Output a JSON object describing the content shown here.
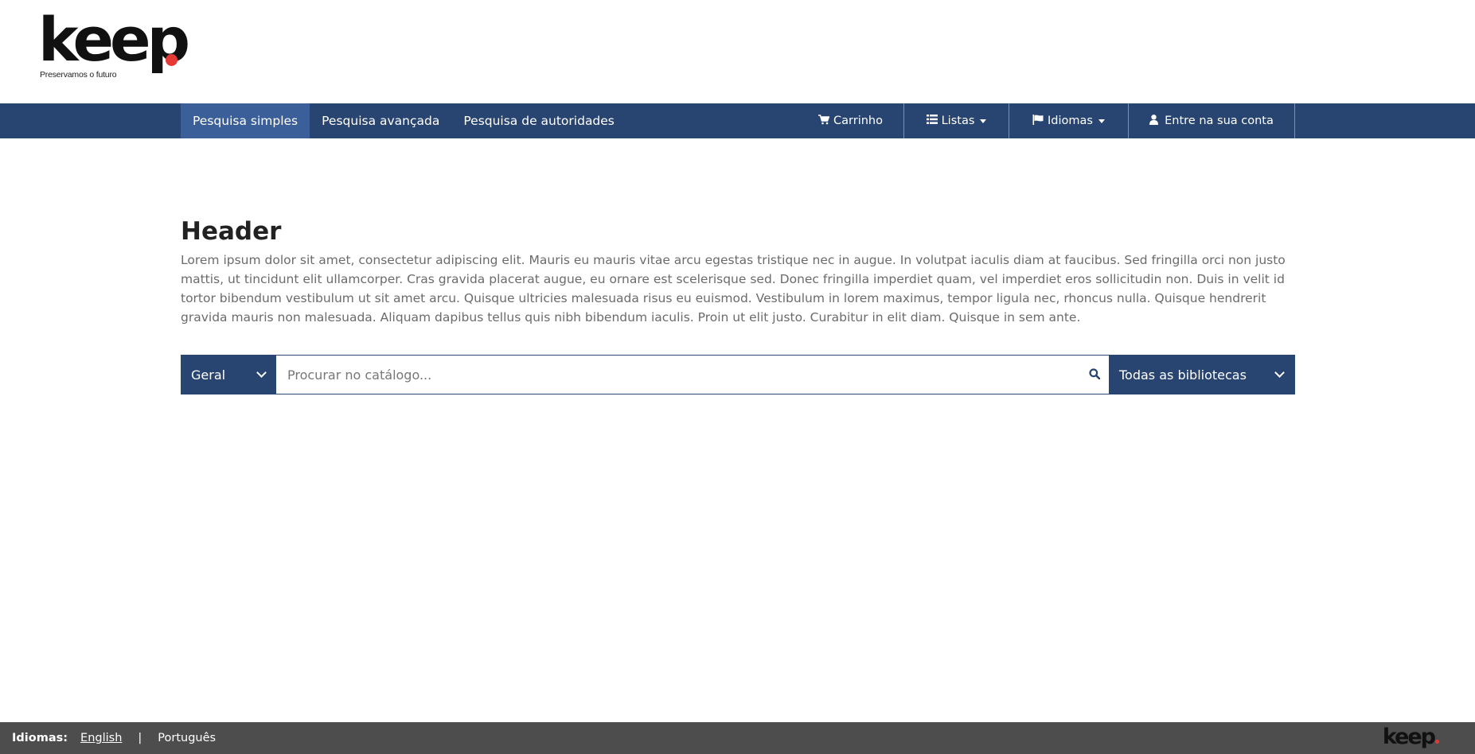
{
  "colors": {
    "primary": "#284471",
    "active_nav": "#3a5f99",
    "accent_dot": "#e53935",
    "footer_bg": "#4d4d4d"
  },
  "logo": {
    "word": "keep",
    "tagline": "Preservamos o futuro"
  },
  "nav": {
    "left": [
      {
        "label": "Pesquisa simples",
        "active": true
      },
      {
        "label": "Pesquisa avançada",
        "active": false
      },
      {
        "label": "Pesquisa de autoridades",
        "active": false
      }
    ],
    "cart": {
      "label": "Carrinho",
      "icon": "shopping-cart-icon"
    },
    "lists": {
      "label": "Listas",
      "icon": "list-icon"
    },
    "languages": {
      "label": "Idiomas",
      "icon": "flag-icon"
    },
    "login": {
      "label": "Entre na sua conta",
      "icon": "user-icon"
    }
  },
  "main": {
    "title": "Header",
    "intro": "Lorem ipsum dolor sit amet, consectetur adipiscing elit. Mauris eu mauris vitae arcu egestas tristique nec in augue. In volutpat iaculis diam at faucibus. Sed fringilla orci non justo mattis, ut tincidunt elit ullamcorper. Cras gravida placerat augue, eu ornare est scelerisque sed. Donec fringilla imperdiet quam, vel imperdiet eros sollicitudin non. Duis in velit id tortor bibendum vestibulum ut sit amet arcu. Quisque ultricies malesuada risus eu euismod. Vestibulum in lorem maximus, tempor ligula nec, rhoncus nulla. Quisque hendrerit gravida mauris non malesuada. Aliquam dapibus tellus quis nibh bibendum iaculis. Proin ut elit justo. Curabitur in elit diam. Quisque in sem ante."
  },
  "search": {
    "scope": "Geral",
    "placeholder": "Procurar no catálogo...",
    "value": "",
    "library": "Todas as bibliotecas",
    "button_icon": "search-icon"
  },
  "footer": {
    "label": "Idiomas:",
    "languages": [
      "English",
      "Português"
    ],
    "separator": "|",
    "logo_word": "keep"
  }
}
